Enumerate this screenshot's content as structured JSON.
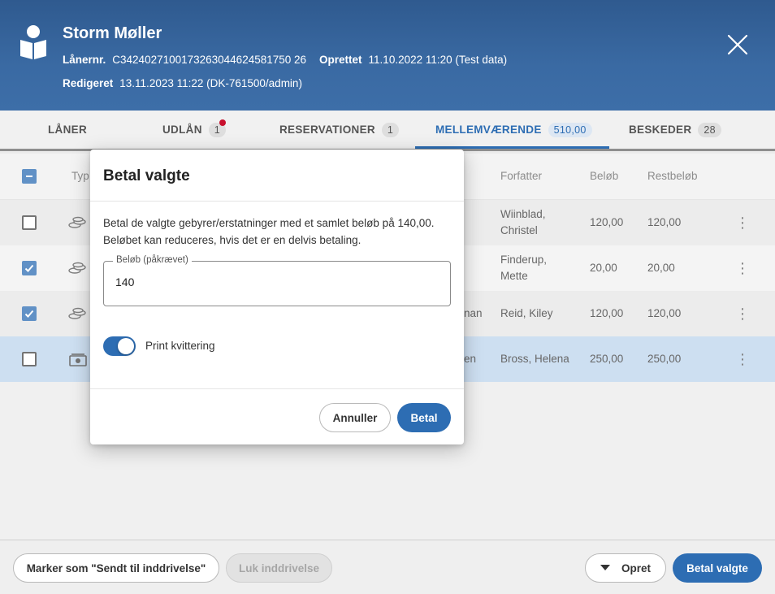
{
  "header": {
    "name": "Storm Møller",
    "loaner_label": "Lånernr.",
    "loaner_value": "C3424027100173263044624581750 26",
    "created_label": "Oprettet",
    "created_value": "11.10.2022 11:20 (Test data)",
    "edited_label": "Redigeret",
    "edited_value": "13.11.2023 11:22 (DK-761500/admin)",
    "icons": {
      "avatar": "reader-avatar-icon",
      "close": "close-icon"
    }
  },
  "tabs": [
    {
      "label": "LÅNER",
      "count": ""
    },
    {
      "label": "UDLÅN",
      "count": "1"
    },
    {
      "label": "RESERVATIONER",
      "count": "1"
    },
    {
      "label": "MELLEMVÆRENDE",
      "count": "510,00"
    },
    {
      "label": "BESKEDER",
      "count": "28"
    }
  ],
  "table": {
    "columns": {
      "type": "Typ",
      "author": "Forfatter",
      "amount": "Beløb",
      "rest": "Restbeløb"
    },
    "rows": [
      {
        "title_tail": "",
        "author1": "Wiinblad,",
        "author2": "Christel",
        "amount": "120,00",
        "rest": "120,00",
        "checked": false,
        "icon": "coins-icon"
      },
      {
        "title_tail": "",
        "author1": "Finderup,",
        "author2": "Mette",
        "amount": "20,00",
        "rest": "20,00",
        "checked": true,
        "icon": "coins-icon"
      },
      {
        "title_tail": "nan",
        "author1": "Reid, Kiley",
        "author2": "",
        "amount": "120,00",
        "rest": "120,00",
        "checked": true,
        "icon": "coins-icon"
      },
      {
        "title_tail": "en",
        "author1": "Bross, Helena",
        "author2": "",
        "amount": "250,00",
        "rest": "250,00",
        "checked": false,
        "icon": "banknote-icon"
      }
    ]
  },
  "footer": {
    "mark_sent": "Marker som \"Sendt til inddrivelse\"",
    "close_collection": "Luk inddrivelse",
    "create": "Opret",
    "pay_selected": "Betal valgte"
  },
  "dialog": {
    "title": "Betal valgte",
    "text": "Betal de valgte gebyrer/erstatninger med et samlet beløb på 140,00. Beløbet kan reduceres, hvis det er en delvis betaling.",
    "field_label": "Beløb (påkrævet)",
    "field_value": "140",
    "toggle_label": "Print kvittering",
    "toggle_on": true,
    "cancel": "Annuller",
    "pay": "Betal"
  },
  "colors": {
    "header": "#3a6aa3",
    "accent": "#2d6db3",
    "selected_row": "#bdd4ec",
    "badge_dot": "#c8102e"
  }
}
